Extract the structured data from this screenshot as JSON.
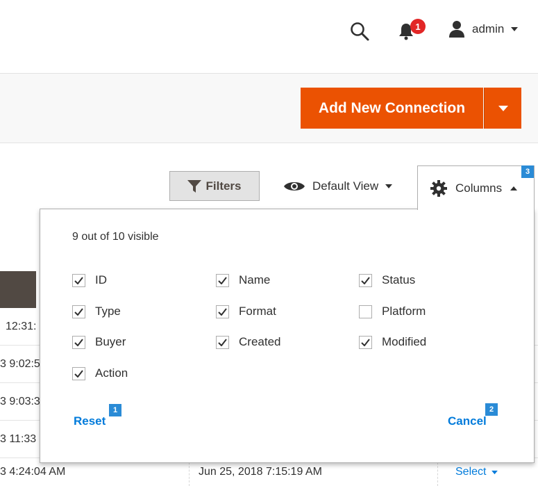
{
  "header": {
    "notification_count": "1",
    "user_label": "admin",
    "icons": [
      "search-icon",
      "bell-icon",
      "user-icon",
      "caret-down-icon"
    ]
  },
  "actions": {
    "add_button_label": "Add New Connection",
    "accent_color": "#eb5202"
  },
  "toolbar": {
    "filters_label": "Filters",
    "view_label": "Default View",
    "columns_label": "Columns"
  },
  "columns_panel": {
    "visible_count_text": "9 out of 10 visible",
    "options": [
      {
        "label": "ID",
        "checked": true
      },
      {
        "label": "Name",
        "checked": true
      },
      {
        "label": "Status",
        "checked": true
      },
      {
        "label": "Type",
        "checked": true
      },
      {
        "label": "Format",
        "checked": true
      },
      {
        "label": "Platform",
        "checked": false
      },
      {
        "label": "Buyer",
        "checked": true
      },
      {
        "label": "Created",
        "checked": true
      },
      {
        "label": "Modified",
        "checked": true
      },
      {
        "label": "Action",
        "checked": true
      }
    ],
    "reset_label": "Reset",
    "cancel_label": "Cancel"
  },
  "grid": {
    "rows": [
      {
        "left_fragment": "12:31:"
      },
      {
        "left_fragment": "3 9:02:5"
      },
      {
        "left_fragment": "3 9:03:3"
      },
      {
        "left_fragment": "3 11:33"
      },
      {
        "left_fragment": "3 4:24:04 AM",
        "modified": "Jun 25, 2018 7:15:19 AM",
        "action": "Select"
      }
    ]
  },
  "markers": [
    "1",
    "2",
    "3"
  ]
}
